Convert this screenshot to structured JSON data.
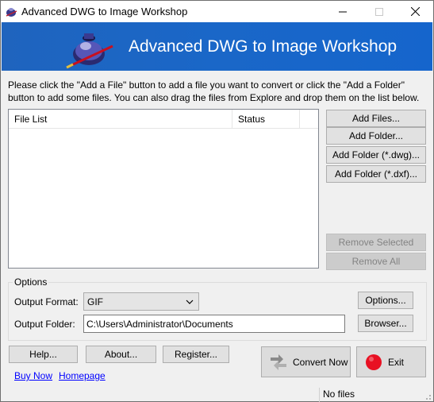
{
  "window": {
    "title": "Advanced DWG to Image Workshop",
    "controls": {
      "minimize": "—",
      "maximize": "☐",
      "close": "✕"
    }
  },
  "banner": {
    "title": "Advanced DWG to Image Workshop",
    "logo_icon": "ink-pot-quill-icon"
  },
  "instructions": "Please click the \"Add a File\" button to add a file you want to convert or click the \"Add a Folder\" button to add some files. You can also drag the files from Explore and drop them on the list below.",
  "file_list": {
    "columns": [
      "File List",
      "Status"
    ],
    "rows": []
  },
  "side_buttons": {
    "add_files": "Add Files...",
    "add_folder": "Add Folder...",
    "add_folder_dwg": "Add Folder (*.dwg)...",
    "add_folder_dxf": "Add Folder (*.dxf)...",
    "remove_selected": "Remove Selected",
    "remove_all": "Remove All"
  },
  "options": {
    "group_label": "Options",
    "output_format_label": "Output Format:",
    "output_format_value": "GIF",
    "output_folder_label": "Output Folder:",
    "output_folder_value": "C:\\Users\\Administrator\\Documents",
    "options_button": "Options...",
    "browse_button": "Browser..."
  },
  "bottom": {
    "help": "Help...",
    "about": "About...",
    "register": "Register...",
    "buy_now": "Buy Now",
    "homepage": "Homepage",
    "convert_now": "Convert Now",
    "exit": "Exit"
  },
  "status_bar": {
    "text": "No files"
  },
  "colors": {
    "banner": "#1a67c8",
    "link": "#0000ff",
    "exit_red": "#e81123"
  }
}
